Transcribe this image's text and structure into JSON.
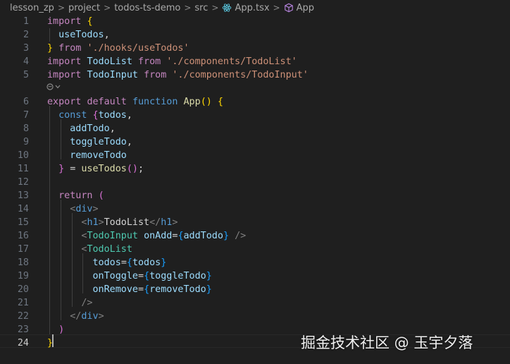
{
  "breadcrumb": {
    "items": [
      "lesson_zp",
      "project",
      "todos-ts-demo",
      "src",
      "App.tsx",
      "App"
    ],
    "separator": ">"
  },
  "editor": {
    "active_line": 24,
    "code_lens_icon": "copilot-icon",
    "lines": [
      {
        "num": "1",
        "tokens": [
          {
            "t": "import",
            "c": "kw"
          },
          {
            "t": " ",
            "c": "pl"
          },
          {
            "t": "{",
            "c": "b1"
          }
        ]
      },
      {
        "num": "2",
        "tokens": [
          {
            "t": "  useTodos",
            "c": "var"
          },
          {
            "t": ",",
            "c": "pl"
          }
        ]
      },
      {
        "num": "3",
        "tokens": [
          {
            "t": "}",
            "c": "b1"
          },
          {
            "t": " ",
            "c": "pl"
          },
          {
            "t": "from",
            "c": "kw"
          },
          {
            "t": " ",
            "c": "pl"
          },
          {
            "t": "'./hooks/useTodos'",
            "c": "str"
          }
        ]
      },
      {
        "num": "4",
        "tokens": [
          {
            "t": "import",
            "c": "kw"
          },
          {
            "t": " ",
            "c": "pl"
          },
          {
            "t": "TodoList",
            "c": "var"
          },
          {
            "t": " ",
            "c": "pl"
          },
          {
            "t": "from",
            "c": "kw"
          },
          {
            "t": " ",
            "c": "pl"
          },
          {
            "t": "'./components/TodoList'",
            "c": "str"
          }
        ]
      },
      {
        "num": "5",
        "tokens": [
          {
            "t": "import",
            "c": "kw"
          },
          {
            "t": " ",
            "c": "pl"
          },
          {
            "t": "TodoInput",
            "c": "var"
          },
          {
            "t": " ",
            "c": "pl"
          },
          {
            "t": "from",
            "c": "kw"
          },
          {
            "t": " ",
            "c": "pl"
          },
          {
            "t": "'./components/TodoInput'",
            "c": "str"
          }
        ]
      },
      {
        "num": "6",
        "tokens": [
          {
            "t": "export",
            "c": "kw"
          },
          {
            "t": " ",
            "c": "pl"
          },
          {
            "t": "default",
            "c": "kw"
          },
          {
            "t": " ",
            "c": "pl"
          },
          {
            "t": "function",
            "c": "kb"
          },
          {
            "t": " ",
            "c": "pl"
          },
          {
            "t": "App",
            "c": "fn"
          },
          {
            "t": "()",
            "c": "b1"
          },
          {
            "t": " ",
            "c": "pl"
          },
          {
            "t": "{",
            "c": "b1"
          }
        ]
      },
      {
        "num": "7",
        "tokens": [
          {
            "t": "  ",
            "c": "pl"
          },
          {
            "t": "const",
            "c": "kb"
          },
          {
            "t": " ",
            "c": "pl"
          },
          {
            "t": "{",
            "c": "b2"
          },
          {
            "t": "todos",
            "c": "var"
          },
          {
            "t": ",",
            "c": "pl"
          }
        ]
      },
      {
        "num": "8",
        "tokens": [
          {
            "t": "    addTodo",
            "c": "var"
          },
          {
            "t": ",",
            "c": "pl"
          }
        ]
      },
      {
        "num": "9",
        "tokens": [
          {
            "t": "    toggleTodo",
            "c": "var"
          },
          {
            "t": ",",
            "c": "pl"
          }
        ]
      },
      {
        "num": "10",
        "tokens": [
          {
            "t": "    removeTodo",
            "c": "var"
          }
        ]
      },
      {
        "num": "11",
        "tokens": [
          {
            "t": "  ",
            "c": "pl"
          },
          {
            "t": "}",
            "c": "b2"
          },
          {
            "t": " = ",
            "c": "pl"
          },
          {
            "t": "useTodos",
            "c": "fn"
          },
          {
            "t": "()",
            "c": "b2"
          },
          {
            "t": ";",
            "c": "pl"
          }
        ]
      },
      {
        "num": "12",
        "tokens": []
      },
      {
        "num": "13",
        "tokens": [
          {
            "t": "  ",
            "c": "pl"
          },
          {
            "t": "return",
            "c": "kw"
          },
          {
            "t": " ",
            "c": "pl"
          },
          {
            "t": "(",
            "c": "b2"
          }
        ]
      },
      {
        "num": "14",
        "tokens": [
          {
            "t": "    ",
            "c": "pl"
          },
          {
            "t": "<",
            "c": "tg"
          },
          {
            "t": "div",
            "c": "kb"
          },
          {
            "t": ">",
            "c": "tg"
          }
        ]
      },
      {
        "num": "15",
        "tokens": [
          {
            "t": "      ",
            "c": "pl"
          },
          {
            "t": "<",
            "c": "tg"
          },
          {
            "t": "h1",
            "c": "kb"
          },
          {
            "t": ">",
            "c": "tg"
          },
          {
            "t": "TodoList",
            "c": "pl"
          },
          {
            "t": "</",
            "c": "tg"
          },
          {
            "t": "h1",
            "c": "kb"
          },
          {
            "t": ">",
            "c": "tg"
          }
        ]
      },
      {
        "num": "16",
        "tokens": [
          {
            "t": "      ",
            "c": "pl"
          },
          {
            "t": "<",
            "c": "tg"
          },
          {
            "t": "TodoInput",
            "c": "cls"
          },
          {
            "t": " ",
            "c": "pl"
          },
          {
            "t": "onAdd",
            "c": "var"
          },
          {
            "t": "=",
            "c": "pl"
          },
          {
            "t": "{",
            "c": "b3"
          },
          {
            "t": "addTodo",
            "c": "var"
          },
          {
            "t": "}",
            "c": "b3"
          },
          {
            "t": " ",
            "c": "pl"
          },
          {
            "t": "/>",
            "c": "tg"
          }
        ]
      },
      {
        "num": "17",
        "tokens": [
          {
            "t": "      ",
            "c": "pl"
          },
          {
            "t": "<",
            "c": "tg"
          },
          {
            "t": "TodoList",
            "c": "cls"
          }
        ]
      },
      {
        "num": "18",
        "tokens": [
          {
            "t": "        todos",
            "c": "var"
          },
          {
            "t": "=",
            "c": "pl"
          },
          {
            "t": "{",
            "c": "b3"
          },
          {
            "t": "todos",
            "c": "var"
          },
          {
            "t": "}",
            "c": "b3"
          }
        ]
      },
      {
        "num": "19",
        "tokens": [
          {
            "t": "        onToggle",
            "c": "var"
          },
          {
            "t": "=",
            "c": "pl"
          },
          {
            "t": "{",
            "c": "b3"
          },
          {
            "t": "toggleTodo",
            "c": "var"
          },
          {
            "t": "}",
            "c": "b3"
          }
        ]
      },
      {
        "num": "20",
        "tokens": [
          {
            "t": "        onRemove",
            "c": "var"
          },
          {
            "t": "=",
            "c": "pl"
          },
          {
            "t": "{",
            "c": "b3"
          },
          {
            "t": "removeTodo",
            "c": "var"
          },
          {
            "t": "}",
            "c": "b3"
          }
        ]
      },
      {
        "num": "21",
        "tokens": [
          {
            "t": "      ",
            "c": "pl"
          },
          {
            "t": "/>",
            "c": "tg"
          }
        ]
      },
      {
        "num": "22",
        "tokens": [
          {
            "t": "    ",
            "c": "pl"
          },
          {
            "t": "</",
            "c": "tg"
          },
          {
            "t": "div",
            "c": "kb"
          },
          {
            "t": ">",
            "c": "tg"
          }
        ]
      },
      {
        "num": "23",
        "tokens": [
          {
            "t": "  ",
            "c": "pl"
          },
          {
            "t": ")",
            "c": "b2"
          }
        ]
      },
      {
        "num": "24",
        "tokens": [
          {
            "t": "}",
            "c": "b1"
          }
        ]
      }
    ]
  },
  "watermark": "掘金技术社区 @ 玉宇夕落",
  "colors": {
    "background": "#1f1f1f",
    "keyword": "#c586c0",
    "storage": "#569cd6",
    "function": "#dcdcaa",
    "string": "#ce9178",
    "variable": "#9cdcfe",
    "component": "#4ec9b0",
    "bracket_gold": "#ffd700",
    "bracket_purple": "#da70d6",
    "bracket_blue": "#179fff"
  }
}
